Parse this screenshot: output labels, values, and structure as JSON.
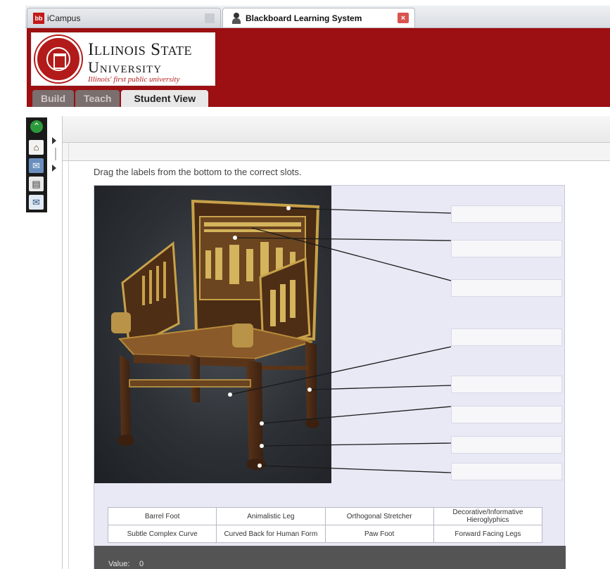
{
  "browser": {
    "tabs": [
      {
        "favicon_text": "bb",
        "label": "iCampus",
        "active": false
      },
      {
        "label": "Blackboard Learning System",
        "active": true
      }
    ],
    "close_glyph": "×"
  },
  "banner": {
    "university_line1": "Illinois State",
    "university_line2": "University",
    "tagline": "Illinois' first public university",
    "background_color": "#9c0f12",
    "mode_tabs": [
      {
        "label": "Build",
        "active": false
      },
      {
        "label": "Teach",
        "active": false
      },
      {
        "label": "Student View",
        "active": true
      }
    ]
  },
  "toolbar": {
    "icons": [
      "up-arrow-icon",
      "home-icon",
      "message-icon",
      "document-icon",
      "mail-icon"
    ],
    "glyphs": {
      "up": "⌃",
      "home": "⌂",
      "msg": "✉",
      "doc": "▤",
      "mail": "✉"
    }
  },
  "activity": {
    "instructions": "Drag the labels from the bottom to the correct slots.",
    "slots_count": 8,
    "labels": [
      [
        "Barrel Foot",
        "Animalistic Leg",
        "Orthogonal Stretcher",
        "Decorative/Informative Hieroglyphics"
      ],
      [
        "Subtle Complex Curve",
        "Curved Back for Human Form",
        "Paw Foot",
        "Forward Facing Legs"
      ]
    ],
    "status_label": "Value:",
    "status_value": "0"
  }
}
